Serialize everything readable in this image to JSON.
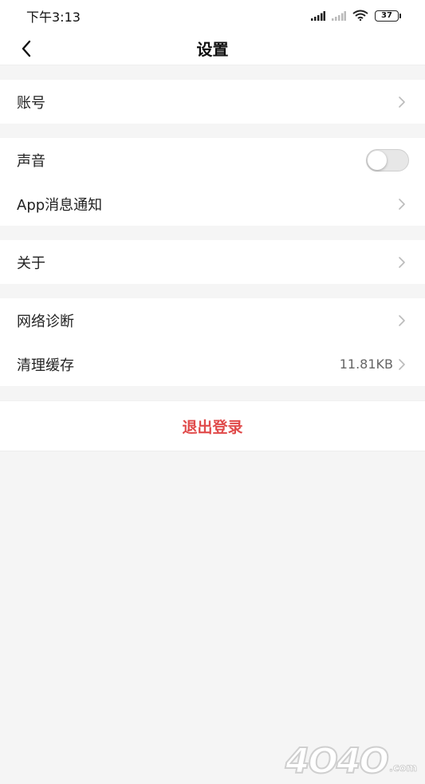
{
  "status_bar": {
    "time": "下午3:13",
    "battery_level": "37",
    "icons": [
      "signal-icon",
      "signal-icon-secondary",
      "wifi-icon",
      "battery-icon"
    ]
  },
  "header": {
    "title": "设置",
    "back_icon": "chevron-left-icon"
  },
  "sections": {
    "account": {
      "label": "账号"
    },
    "sound": {
      "label": "声音",
      "enabled": false
    },
    "app_notify": {
      "label": "App消息通知"
    },
    "about": {
      "label": "关于"
    },
    "network": {
      "label": "网络诊断"
    },
    "cache": {
      "label": "清理缓存",
      "value": "11.81KB"
    }
  },
  "logout": {
    "label": "退出登录",
    "color": "#e04a4a"
  },
  "watermark": {
    "text": "4O4O",
    "suffix": ".com"
  },
  "colors": {
    "accent": "#e04a4a",
    "background": "#f5f5f5",
    "chevron": "#bbbbbb"
  }
}
